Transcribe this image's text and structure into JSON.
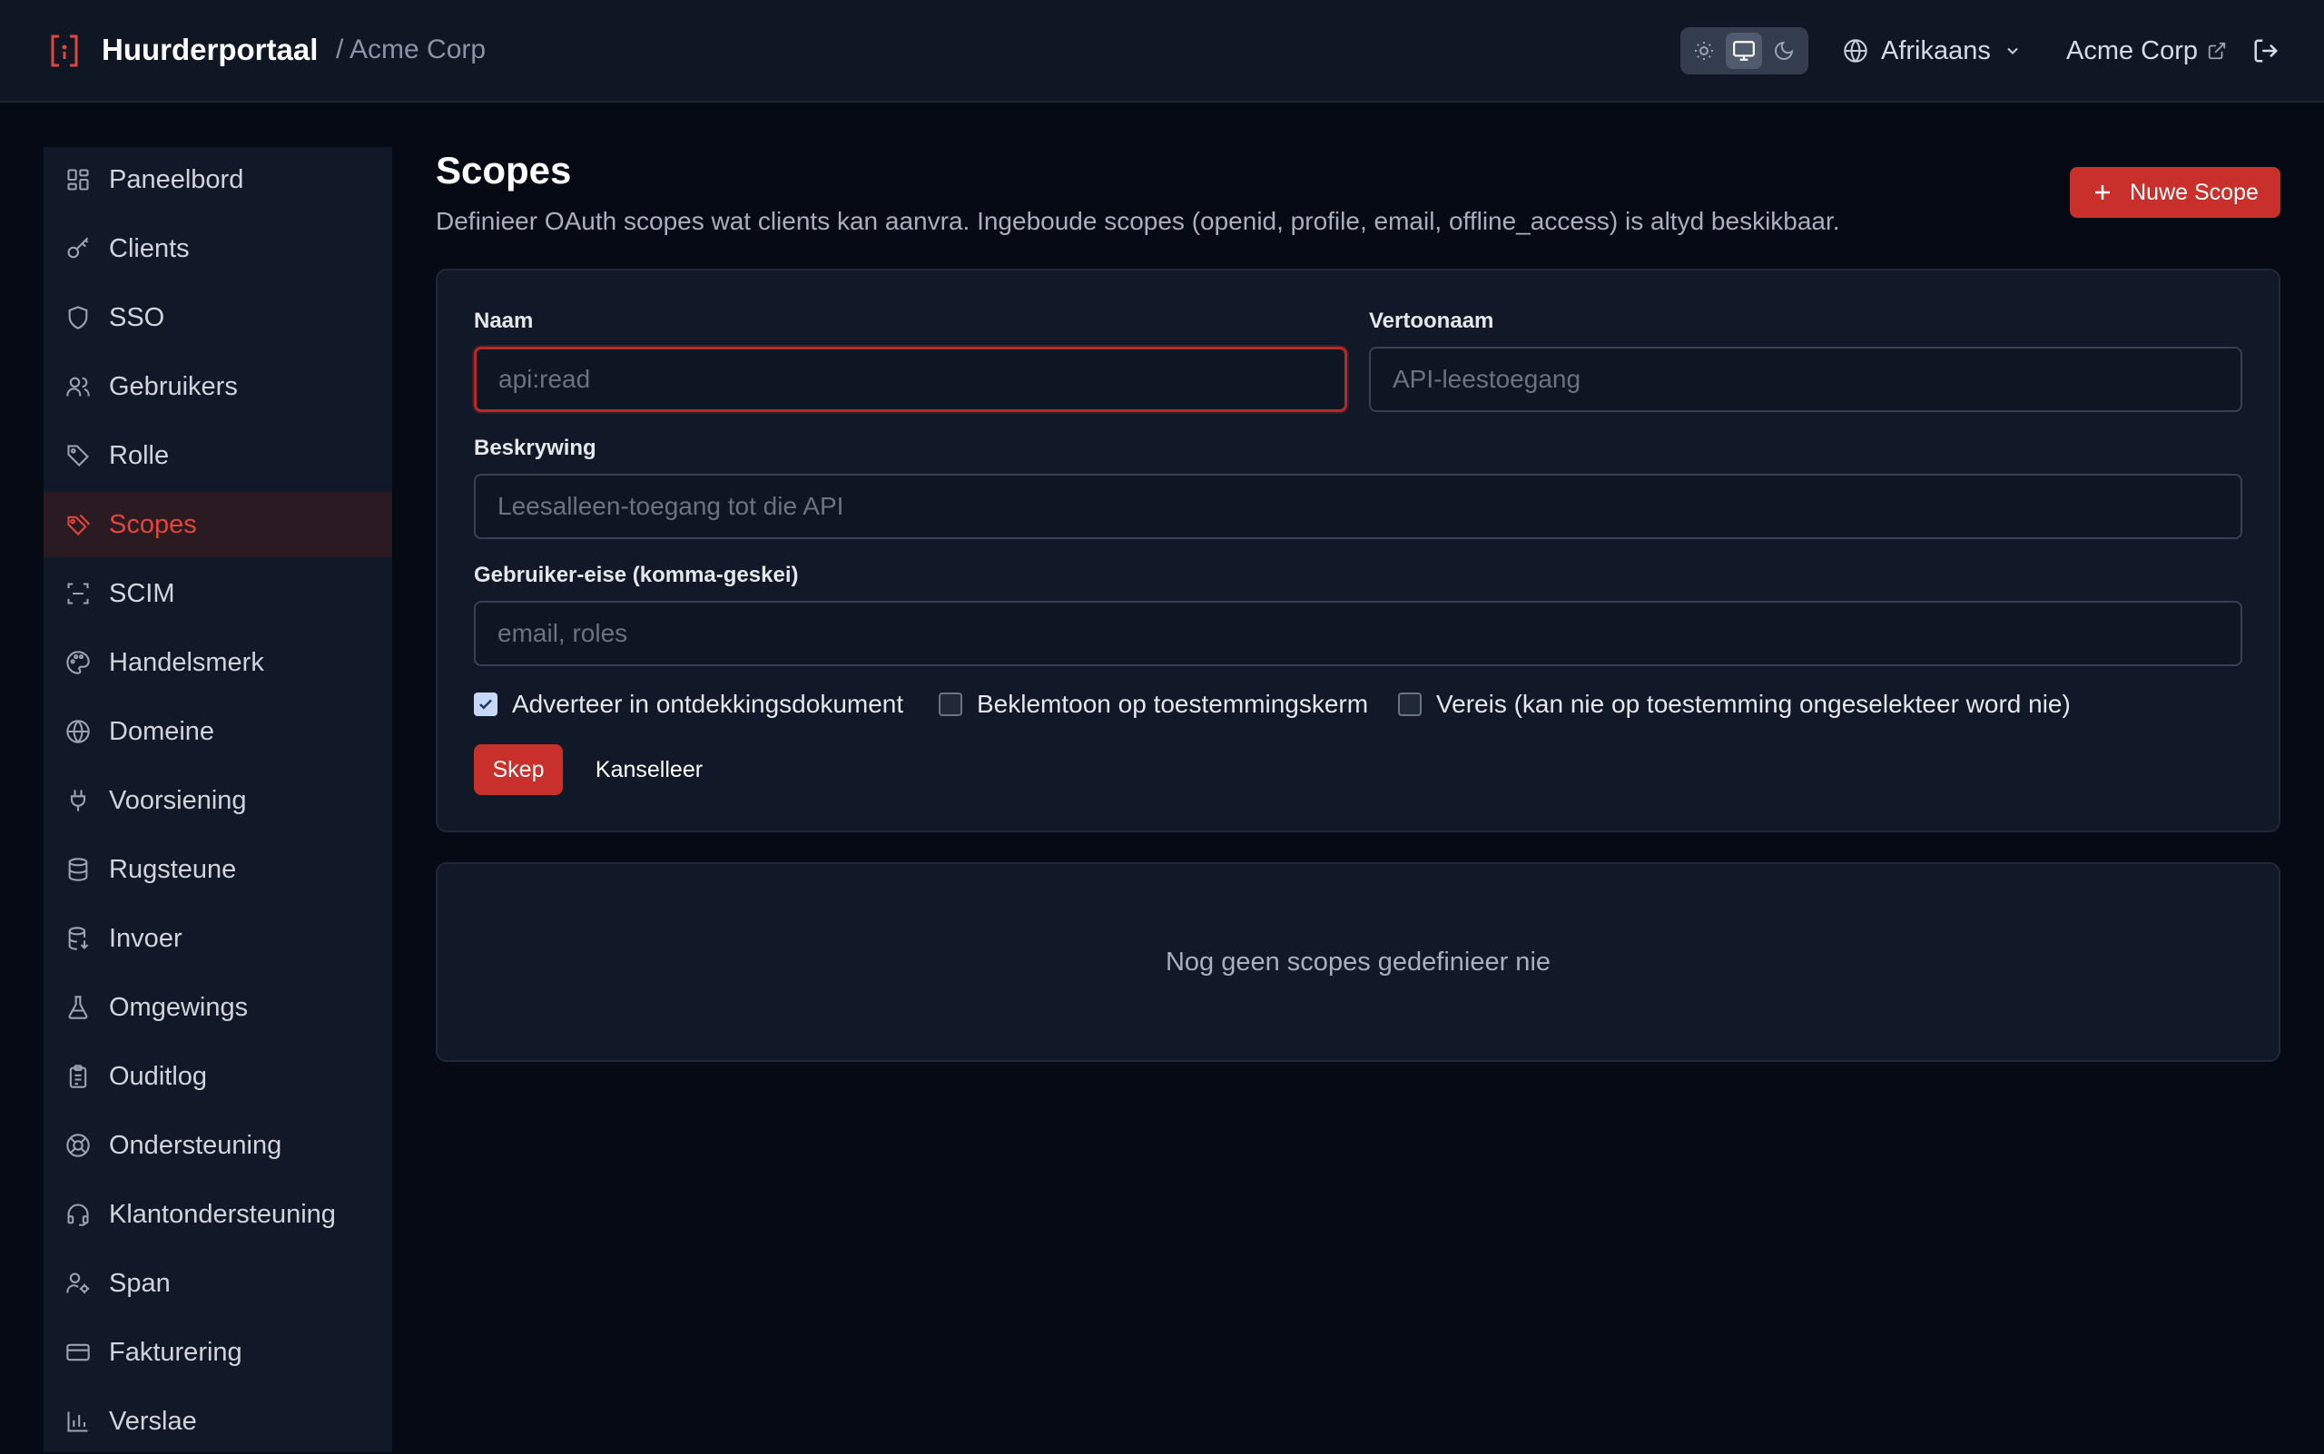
{
  "header": {
    "brand": "Huurderportaal",
    "breadcrumb": "/ Acme Corp",
    "language": "Afrikaans",
    "org_link": "Acme Corp",
    "theme": {
      "selected": "system",
      "options": [
        "light",
        "system",
        "dark"
      ]
    }
  },
  "sidebar": {
    "items": [
      {
        "label": "Paneelbord",
        "icon": "dashboard-icon"
      },
      {
        "label": "Clients",
        "icon": "key-icon"
      },
      {
        "label": "SSO",
        "icon": "shield-icon"
      },
      {
        "label": "Gebruikers",
        "icon": "users-icon"
      },
      {
        "label": "Rolle",
        "icon": "tag-icon"
      },
      {
        "label": "Scopes",
        "icon": "tags-icon",
        "active": true
      },
      {
        "label": "SCIM",
        "icon": "scan-icon"
      },
      {
        "label": "Handelsmerk",
        "icon": "palette-icon"
      },
      {
        "label": "Domeine",
        "icon": "globe-icon"
      },
      {
        "label": "Voorsiening",
        "icon": "plug-icon"
      },
      {
        "label": "Rugsteune",
        "icon": "database-icon"
      },
      {
        "label": "Invoer",
        "icon": "database-import-icon"
      },
      {
        "label": "Omgewings",
        "icon": "flask-icon"
      },
      {
        "label": "Ouditlog",
        "icon": "clipboard-icon"
      },
      {
        "label": "Ondersteuning",
        "icon": "lifebuoy-icon"
      },
      {
        "label": "Klantondersteuning",
        "icon": "headset-icon"
      },
      {
        "label": "Span",
        "icon": "user-cog-icon"
      },
      {
        "label": "Fakturering",
        "icon": "credit-card-icon"
      },
      {
        "label": "Verslae",
        "icon": "bar-chart-icon"
      }
    ]
  },
  "main": {
    "title": "Scopes",
    "description": "Definieer OAuth scopes wat clients kan aanvra. Ingeboude scopes (openid, profile, email, offline_access) is altyd beskikbaar.",
    "new_button": "Nuwe Scope",
    "form": {
      "name_label": "Naam",
      "name_placeholder": "api:read",
      "display_label": "Vertoonaam",
      "display_placeholder": "API-leestoegang",
      "desc_label": "Beskrywing",
      "desc_placeholder": "Leesalleen-toegang tot die API",
      "claims_label": "Gebruiker-eise (komma-geskei)",
      "claims_placeholder": "email, roles",
      "checkbox_advertise": "Adverteer in ontdekkingsdokument",
      "checkbox_advertise_checked": true,
      "checkbox_emphasize": "Beklemtoon op toestemmingskerm",
      "checkbox_emphasize_checked": false,
      "checkbox_required": "Vereis (kan nie op toestemming ongeselekteer word nie)",
      "checkbox_required_checked": false,
      "create_button": "Skep",
      "cancel_button": "Kanselleer"
    },
    "empty_text": "Nog geen scopes gedefinieer nie"
  },
  "colors": {
    "accent": "#c9302c",
    "active_text": "#e0463b"
  }
}
